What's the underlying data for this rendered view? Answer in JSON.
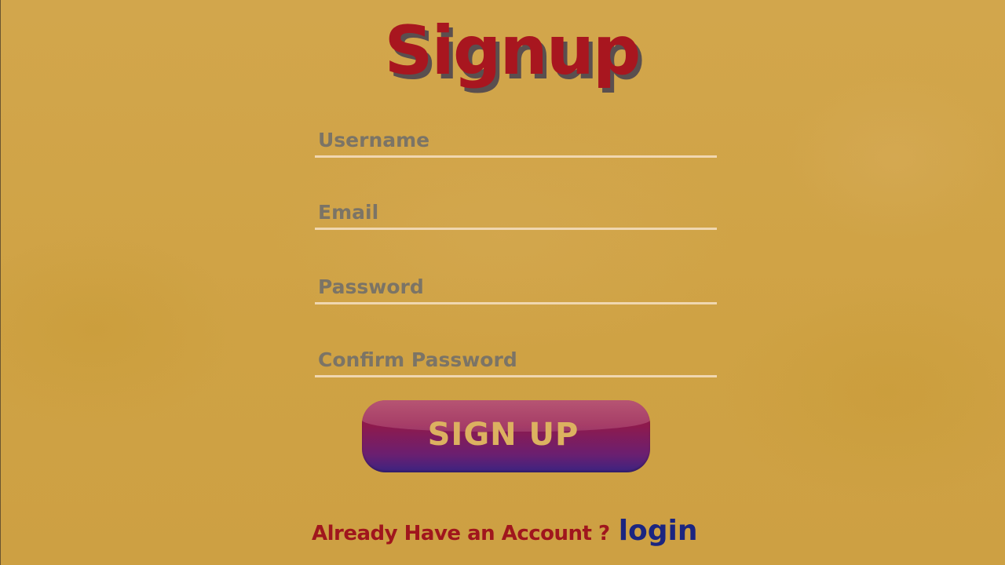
{
  "title": "Signup",
  "fields": {
    "username": {
      "placeholder": "Username",
      "value": ""
    },
    "email": {
      "placeholder": "Email",
      "value": ""
    },
    "password": {
      "placeholder": "Password",
      "value": ""
    },
    "confirm_password": {
      "placeholder": "Confirm Password",
      "value": ""
    }
  },
  "signup_button": {
    "label": "SIGN UP"
  },
  "footer": {
    "question": "Already Have an Account ?",
    "login_link": "login"
  },
  "colors": {
    "background": "#d0a448",
    "title": "#a8161f",
    "title_shadow": "#5a4f4f",
    "field_underline": "#f0d7b0",
    "placeholder": "#7b7466",
    "button_top": "#8f1c45",
    "button_bottom": "#3b2380",
    "button_text": "#dcb160",
    "question_text": "#a0161d",
    "login_text": "#1b2580"
  }
}
